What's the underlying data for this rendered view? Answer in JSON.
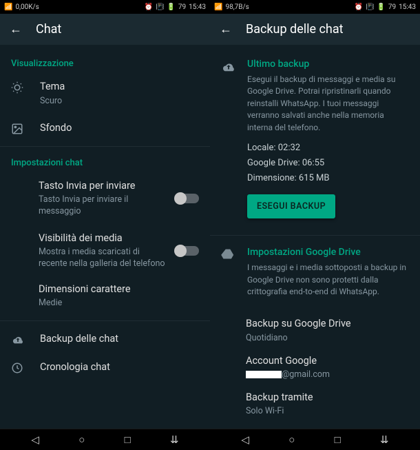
{
  "statusbar": {
    "signal_text": "▂▄▆█",
    "speed_left": "0,00K/s",
    "speed_right": "98,7B/s",
    "alarm": "⏰",
    "vibrate": "📳",
    "battery": "🔋",
    "battery_pct": "79",
    "time": "15:43"
  },
  "left": {
    "title": "Chat",
    "section1": "Visualizzazione",
    "theme": {
      "label": "Tema",
      "value": "Scuro"
    },
    "wallpaper": {
      "label": "Sfondo"
    },
    "section2": "Impostazioni chat",
    "enter": {
      "label": "Tasto Invia per inviare",
      "sub": "Tasto Invia per inviare il messaggio"
    },
    "media": {
      "label": "Visibilità dei media",
      "sub": "Mostra i media scaricati di recente nella galleria del telefono"
    },
    "fontsize": {
      "label": "Dimensioni carattere",
      "value": "Medie"
    },
    "backup": {
      "label": "Backup delle chat"
    },
    "history": {
      "label": "Cronologia chat"
    }
  },
  "right": {
    "title": "Backup delle chat",
    "last_backup_title": "Ultimo backup",
    "last_backup_desc": "Esegui il backup di messaggi e media su Google Drive. Potrai ripristinarli quando reinstalli WhatsApp. I tuoi messaggi verranno salvati anche nella memoria interna del telefono.",
    "local": "Locale: 02:32",
    "gdrive": "Google Drive: 06:55",
    "size": "Dimensione: 615 MB",
    "btn": "ESEGUI BACKUP",
    "gd_title": "Impostazioni Google Drive",
    "gd_desc": "I messaggi e i media sottoposti a backup in Google Drive non sono protetti dalla crittografia end-to-end di WhatsApp.",
    "freq": {
      "label": "Backup su Google Drive",
      "value": "Quotidiano"
    },
    "account": {
      "label": "Account Google",
      "value": "@gmail.com"
    },
    "via": {
      "label": "Backup tramite",
      "value": "Solo Wi-Fi"
    }
  }
}
